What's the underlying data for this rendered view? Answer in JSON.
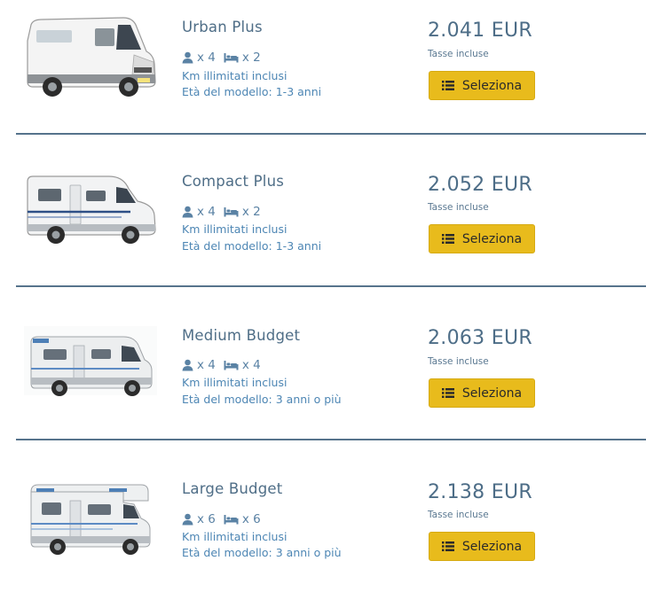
{
  "colors": {
    "accent": "#e8bb1c",
    "title": "#4f6e87",
    "link": "#4d86b4",
    "divider": "#56738c"
  },
  "icons": {
    "persons": "person-icon",
    "beds": "bed-icon",
    "button": "list-icon"
  },
  "items": [
    {
      "name": "Urban Plus",
      "persons": "x 4",
      "beds": "x 2",
      "km": "Km illimitati inclusi",
      "age": "Età del modello: 1-3 anni",
      "price": "2.041 EUR",
      "tax": "Tasse incluse",
      "button": "Seleziona",
      "image": "camper-van"
    },
    {
      "name": "Compact Plus",
      "persons": "x 4",
      "beds": "x 2",
      "km": "Km illimitati inclusi",
      "age": "Età del modello: 1-3 anni",
      "price": "2.052 EUR",
      "tax": "Tasse incluse",
      "button": "Seleziona",
      "image": "semi-integrated-motorhome"
    },
    {
      "name": "Medium Budget",
      "persons": "x 4",
      "beds": "x 4",
      "km": "Km illimitati inclusi",
      "age": "Età del modello: 3 anni o più",
      "price": "2.063 EUR",
      "tax": "Tasse incluse",
      "button": "Seleziona",
      "image": "motorhome-medium"
    },
    {
      "name": "Large Budget",
      "persons": "x 6",
      "beds": "x 6",
      "km": "Km illimitati inclusi",
      "age": "Età del modello: 3 anni o più",
      "price": "2.138 EUR",
      "tax": "Tasse incluse",
      "button": "Seleziona",
      "image": "alcove-motorhome"
    }
  ]
}
